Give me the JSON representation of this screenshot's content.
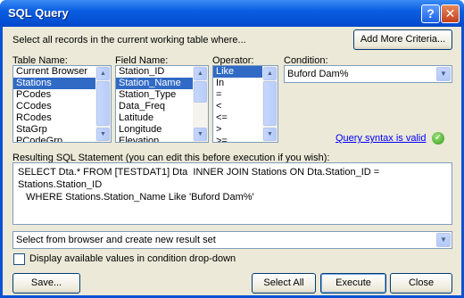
{
  "window": {
    "title": "SQL Query",
    "help_glyph": "?",
    "close_glyph": "✕"
  },
  "description": "Select all records in the current working table where...",
  "add_criteria_label": "Add More Criteria...",
  "table": {
    "label": "Table Name:",
    "items": [
      "Current Browser",
      "Stations",
      "PCodes",
      "CCodes",
      "RCodes",
      "StaGrp",
      "PCodeGrp"
    ],
    "selected": "Stations"
  },
  "field": {
    "label": "Field Name:",
    "items": [
      "Station_ID",
      "Station_Name",
      "Station_Type",
      "Data_Freq",
      "Latitude",
      "Longitude",
      "Elevation"
    ],
    "selected": "Station_Name"
  },
  "operator": {
    "label": "Operator:",
    "items": [
      "Like",
      "In",
      "=",
      "<",
      "<=",
      ">",
      ">="
    ],
    "selected": "Like"
  },
  "condition": {
    "label": "Condition:",
    "value": "Buford Dam%"
  },
  "syntax_link": "Query syntax is valid",
  "sql": {
    "label": "Resulting SQL Statement (you can edit this before execution if you wish):",
    "text": "SELECT Dta.* FROM [TESTDAT1] Dta  INNER JOIN Stations ON Dta.Station_ID = Stations.Station_ID\n   WHERE Stations.Station_Name Like 'Buford Dam%'"
  },
  "result_mode": {
    "value": "Select from browser and create new result set"
  },
  "display_values_label": "Display available values in condition drop-down",
  "buttons": {
    "save": "Save...",
    "select_all": "Select All",
    "execute": "Execute",
    "close": "Close"
  },
  "colors": {
    "selection": "#316ac5",
    "titlebar": "#0b5ee2",
    "dialog_bg": "#ece9d8",
    "valid": "#2f9a18"
  }
}
